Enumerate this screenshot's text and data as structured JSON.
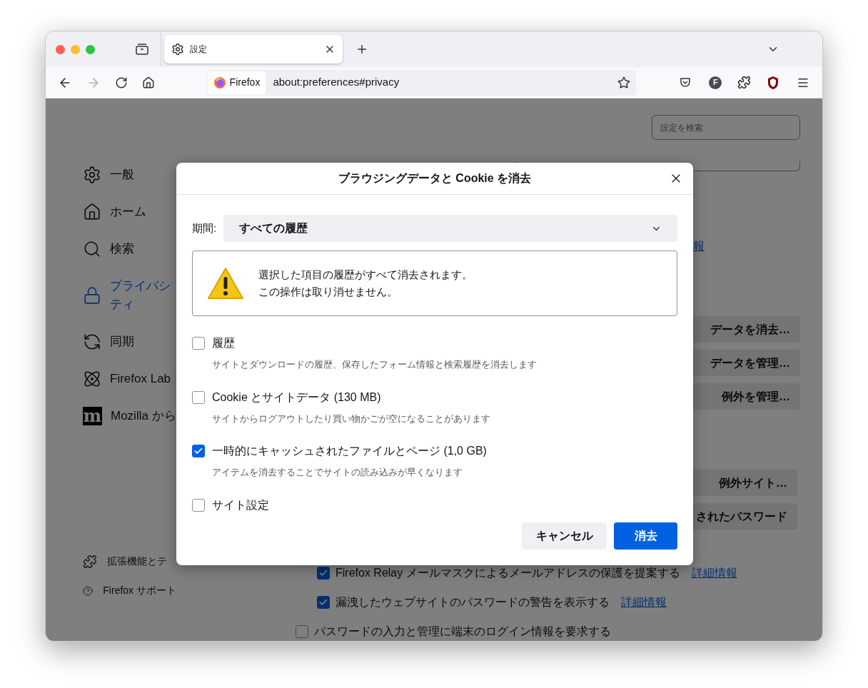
{
  "tab": {
    "title": "設定",
    "selected": true
  },
  "toolbar": {
    "forward_disabled": true,
    "identity": "Firefox",
    "url": "about:preferences#privacy",
    "avatar": "F"
  },
  "sidebar": {
    "items": [
      {
        "kind": "gear",
        "lines": [
          "一般"
        ],
        "selected": false
      },
      {
        "kind": "home",
        "lines": [
          "ホーム"
        ],
        "selected": false
      },
      {
        "kind": "search",
        "lines": [
          "検索"
        ],
        "selected": false
      },
      {
        "kind": "lock",
        "lines": [
          "プライバシ",
          "ティ"
        ],
        "selected": true
      },
      {
        "kind": "sync",
        "lines": [
          "同期"
        ],
        "selected": false
      },
      {
        "kind": "labs",
        "lines": [
          "Firefox Lab"
        ],
        "selected": false
      },
      {
        "kind": "mozilla",
        "lines": [
          "Mozilla から"
        ],
        "logo_text": "m",
        "selected": false
      }
    ],
    "footer": [
      {
        "kind": "puzzle",
        "label": "拡張機能とテ"
      },
      {
        "kind": "help",
        "label": "Firefox サポート"
      }
    ]
  },
  "main": {
    "search": {
      "placeholder": "設定を検索"
    },
    "link": "報",
    "buttons_top": [
      "データを消去…",
      "データを管理…",
      "例外を管理…"
    ],
    "buttons_bottom": [
      "例外サイト…",
      "されたパスワード"
    ],
    "checks": [
      {
        "label": "Firefox Relay メールマスクによるメールアドレスの保護を提案する",
        "link": "詳細情報",
        "checked": true
      },
      {
        "label": "漏洩したウェブサイトのパスワードの警告を表示する",
        "link": "詳細情報",
        "checked": true
      },
      {
        "label": "パスワードの入力と管理に端末のログイン情報を要求する",
        "checked": false
      }
    ]
  },
  "dialog": {
    "title": "ブラウジングデータと Cookie を消去",
    "period_label": "期間:",
    "period_value": "すべての履歴",
    "warning": [
      "選択した項目の履歴がすべて消去されます。",
      "この操作は取り消せません。"
    ],
    "options": [
      {
        "label": "履歴",
        "description": "サイトとダウンロードの履歴、保存したフォーム情報と検索履歴を消去します",
        "checked": false
      },
      {
        "label": "Cookie とサイトデータ (130 MB)",
        "description": "サイトからログアウトしたり買い物かごが空になることがあります",
        "checked": false
      },
      {
        "label": "一時的にキャッシュされたファイルとページ (1,0 GB)",
        "description": "アイテムを消去することでサイトの読み込みが早くなります",
        "checked": true
      },
      {
        "label": "サイト設定",
        "checked": false
      }
    ],
    "cancel": "キャンセル",
    "confirm": "消去"
  }
}
